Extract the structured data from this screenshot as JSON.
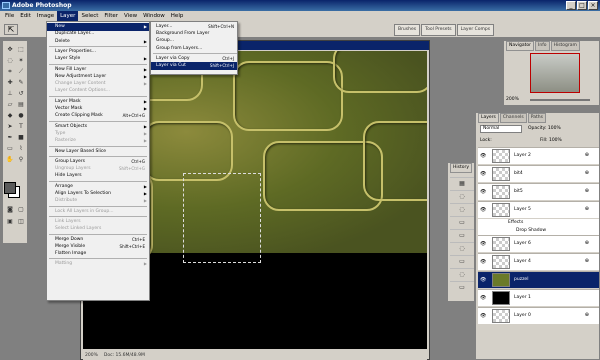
{
  "window": {
    "title": "Adobe Photoshop"
  },
  "menubar": [
    "File",
    "Edit",
    "Image",
    "Layer",
    "Select",
    "Filter",
    "View",
    "Window",
    "Help"
  ],
  "palette_well": {
    "tabs": [
      "Brushes",
      "Tool Presets",
      "Layer Comps"
    ]
  },
  "layer_menu": {
    "items": [
      {
        "label": "New",
        "shortcut": "",
        "submenu": true,
        "highlight": true
      },
      {
        "label": "Duplicate Layer...",
        "shortcut": ""
      },
      {
        "label": "Delete",
        "shortcut": "",
        "submenu": true
      },
      {
        "sep": true
      },
      {
        "label": "Layer Properties...",
        "shortcut": ""
      },
      {
        "label": "Layer Style",
        "shortcut": "",
        "submenu": true
      },
      {
        "sep": true
      },
      {
        "label": "New Fill Layer",
        "shortcut": "",
        "submenu": true
      },
      {
        "label": "New Adjustment Layer",
        "shortcut": "",
        "submenu": true
      },
      {
        "label": "Change Layer Content",
        "shortcut": "",
        "submenu": true,
        "disabled": true
      },
      {
        "label": "Layer Content Options...",
        "shortcut": "",
        "disabled": true
      },
      {
        "sep": true
      },
      {
        "label": "Layer Mask",
        "shortcut": "",
        "submenu": true
      },
      {
        "label": "Vector Mask",
        "shortcut": "",
        "submenu": true
      },
      {
        "label": "Create Clipping Mask",
        "shortcut": "Alt+Ctrl+G"
      },
      {
        "sep": true
      },
      {
        "label": "Smart Objects",
        "shortcut": "",
        "submenu": true
      },
      {
        "label": "Type",
        "shortcut": "",
        "submenu": true,
        "disabled": true
      },
      {
        "label": "Rasterize",
        "shortcut": "",
        "submenu": true,
        "disabled": true
      },
      {
        "sep": true
      },
      {
        "label": "New Layer Based Slice",
        "shortcut": ""
      },
      {
        "sep": true
      },
      {
        "label": "Group Layers",
        "shortcut": "Ctrl+G"
      },
      {
        "label": "Ungroup Layers",
        "shortcut": "Shift+Ctrl+G",
        "disabled": true
      },
      {
        "label": "Hide Layers",
        "shortcut": ""
      },
      {
        "sep": true
      },
      {
        "label": "Arrange",
        "shortcut": "",
        "submenu": true
      },
      {
        "label": "Align Layers To Selection",
        "shortcut": "",
        "submenu": true
      },
      {
        "label": "Distribute",
        "shortcut": "",
        "submenu": true,
        "disabled": true
      },
      {
        "sep": true
      },
      {
        "label": "Lock All Layers in Group...",
        "shortcut": "",
        "disabled": true
      },
      {
        "sep": true
      },
      {
        "label": "Link Layers",
        "shortcut": "",
        "disabled": true
      },
      {
        "label": "Select Linked Layers",
        "shortcut": "",
        "disabled": true
      },
      {
        "sep": true
      },
      {
        "label": "Merge Down",
        "shortcut": "Ctrl+E"
      },
      {
        "label": "Merge Visible",
        "shortcut": "Shift+Ctrl+E"
      },
      {
        "label": "Flatten Image",
        "shortcut": ""
      },
      {
        "sep": true
      },
      {
        "label": "Matting",
        "shortcut": "",
        "submenu": true,
        "disabled": true
      }
    ]
  },
  "new_submenu": {
    "items": [
      {
        "label": "Layer...",
        "shortcut": "Shift+Ctrl+N"
      },
      {
        "label": "Background From Layer",
        "shortcut": ""
      },
      {
        "label": "Group...",
        "shortcut": ""
      },
      {
        "label": "Group from Layers...",
        "shortcut": ""
      },
      {
        "sep": true
      },
      {
        "label": "Layer via Copy",
        "shortcut": "Ctrl+J"
      },
      {
        "label": "Layer via Cut",
        "shortcut": "Shift+Ctrl+J",
        "highlight": true
      }
    ]
  },
  "document": {
    "zoom": "200%",
    "doc_info": "Doc: 15.6M/48.9M"
  },
  "navigator": {
    "tabs": [
      "Navigator",
      "Info",
      "Histogram"
    ],
    "zoom": "200%"
  },
  "layers_panel": {
    "tabs": [
      "Layers",
      "Channels",
      "Paths"
    ],
    "blend_mode": "Normal",
    "opacity": "Opacity: 100%",
    "lock": "Lock:",
    "fill": "Fill: 100%",
    "layers": [
      {
        "name": "Layer 2",
        "fx": true
      },
      {
        "name": "bit4",
        "fx": true
      },
      {
        "name": "bit5",
        "fx": true
      },
      {
        "name": "Layer 5",
        "fx": true,
        "effects": [
          "Effects",
          "Drop Shadow"
        ]
      },
      {
        "name": "Layer 6",
        "fx": true
      },
      {
        "name": "Layer 4",
        "fx": true
      },
      {
        "name": "puzzel",
        "fx": false,
        "selected": true
      },
      {
        "name": "Layer 1",
        "fx": false
      },
      {
        "name": "Layer 0",
        "fx": true
      }
    ]
  },
  "history_panel": {
    "tab": "History"
  }
}
